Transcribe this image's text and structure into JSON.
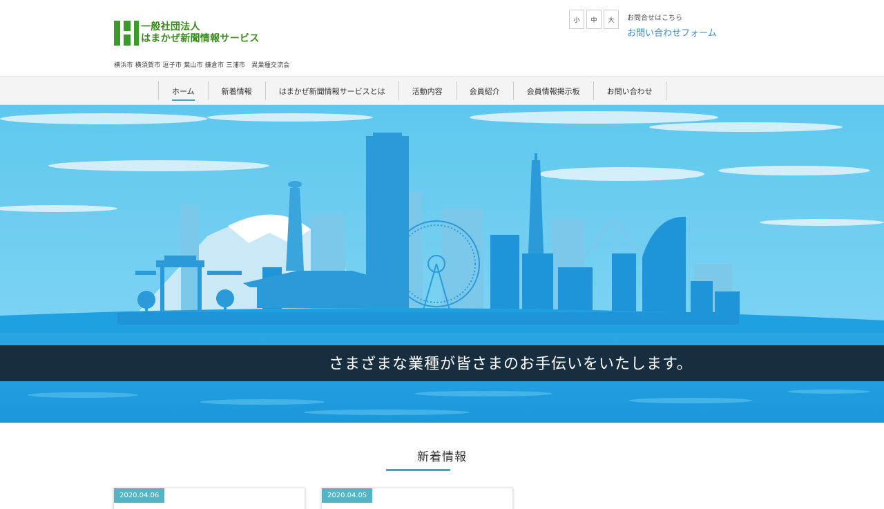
{
  "header": {
    "org_type": "一般社団法人",
    "org_name": "はまかぜ新聞情報サービス",
    "tagline": "横浜市 横須賀市 逗子市 葉山市 鎌倉市 三浦市　異業種交流会",
    "font_sizes": [
      "小",
      "中",
      "大"
    ],
    "contact_lead": "お問合せはこちら",
    "contact_link": "お問い合わせフォーム"
  },
  "nav": {
    "items": [
      {
        "label": "ホーム",
        "active": true
      },
      {
        "label": "新着情報"
      },
      {
        "label": "はまかぜ新聞情報サービスとは"
      },
      {
        "label": "活動内容"
      },
      {
        "label": "会員紹介"
      },
      {
        "label": "会員情報掲示板"
      },
      {
        "label": "お問い合わせ"
      }
    ]
  },
  "hero": {
    "caption": "さまざまな業種が皆さまのお手伝いをいたします。",
    "image": "yokohama-skyline-illustration"
  },
  "news": {
    "title": "新着情報",
    "cards": [
      {
        "date": "2020.04.06"
      },
      {
        "date": "2020.04.05"
      }
    ]
  },
  "colors": {
    "accent": "#3fa7b8",
    "logo_green": "#3a9a2a",
    "link_blue": "#3d8ec9",
    "sky": "#55c3ec",
    "sea": "#1d9fe0"
  }
}
